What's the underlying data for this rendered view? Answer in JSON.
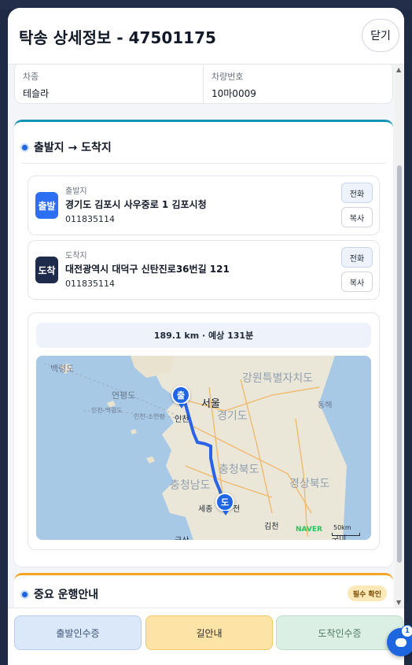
{
  "header": {
    "title": "탁송 상세정보 - 47501175",
    "close_label": "닫기"
  },
  "vehicle": {
    "model_label": "차종",
    "model_value": "테슬라",
    "plate_label": "차량번호",
    "plate_value": "10마0009"
  },
  "route": {
    "section_title": "출발지 → 도착지",
    "start": {
      "badge": "출발",
      "label": "출발지",
      "address": "경기도 김포시 사우중로 1 김포시청",
      "phone": "011835114",
      "call_label": "전화",
      "copy_label": "복사"
    },
    "end": {
      "badge": "도착",
      "label": "도착지",
      "address": "대전광역시 대덕구 신탄진로36번길 121",
      "phone": "011835114",
      "call_label": "전화",
      "copy_label": "복사"
    },
    "distance_text": "189.1 km · 예상 131분"
  },
  "map": {
    "labels": {
      "baengnyeong": "백령도",
      "yeonpyeong": "연평도",
      "incheon_ferry": "인천-백령도",
      "incheon_soyeonpyeong": "인천-소연평",
      "gangwon": "강원특별자치도",
      "seoul": "서울",
      "gyeonggi": "경기도",
      "incheon": "인천",
      "chungbuk": "충청북도",
      "chungnam": "충청남도",
      "gyeongbuk": "경상북도",
      "donghae": "동해",
      "sejong": "세종",
      "daejeon_partial": "전",
      "gimcheon": "김천",
      "gunsan_partial": "군산",
      "gumi_partial": "구미"
    },
    "start_pin": "출",
    "end_pin": "도",
    "naver": "NAVER",
    "scale": "50km",
    "colors": {
      "route": "#2a62e8",
      "pin": "#1f66e5",
      "land": "#eae6d8",
      "sea": "#a7c9e6"
    }
  },
  "notice": {
    "title": "중요 운행안내",
    "badge": "필수 확인"
  },
  "footer": {
    "depart_label": "출발인수증",
    "nav_label": "길안내",
    "arrive_label": "도착인수증"
  },
  "chat": {
    "count": "1"
  }
}
